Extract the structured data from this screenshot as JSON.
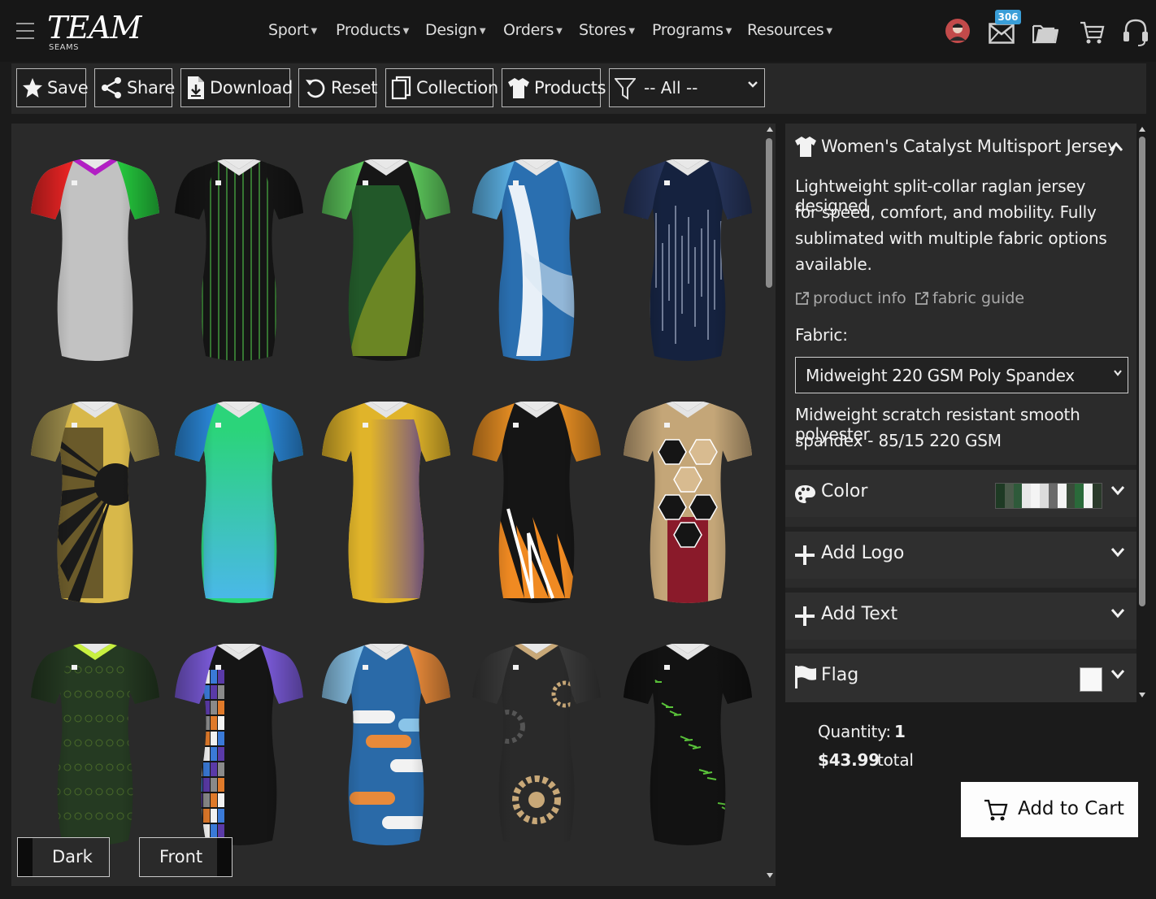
{
  "header": {
    "logo_text": "TEAM",
    "logo_sub": "SEAMS",
    "nav": [
      "Sport",
      "Products",
      "Design",
      "Orders",
      "Stores",
      "Programs",
      "Resources"
    ],
    "mail_count": "306",
    "icons": [
      "menu-icon",
      "avatar-icon",
      "mail-icon",
      "folder-icon",
      "cart-icon",
      "headset-icon"
    ]
  },
  "toolbar": {
    "save": "Save",
    "share": "Share",
    "download": "Download",
    "reset": "Reset",
    "collection": "Collection",
    "products": "Products",
    "filter_value": "-- All --"
  },
  "gallery": {
    "view_buttons": [
      "Dark",
      "Front"
    ],
    "jerseys": [
      {
        "design": "solid",
        "body": "#c2c2c2",
        "sleeve": "#24c43c",
        "sleeve_left": "#e82424",
        "collar": "#b21fc4",
        "accent": "#9a9a9a"
      },
      {
        "design": "stripes",
        "body": "#151515",
        "sleeve": "#151515",
        "collar": "#e4e4e4",
        "accent": "#3f8f3a"
      },
      {
        "design": "hex",
        "body": "#161616",
        "sleeve": "#5bc45a",
        "collar": "#e4e4e4",
        "accent": "#2e8f3a"
      },
      {
        "design": "swoosh",
        "body": "#2a6fb0",
        "sleeve": "#5aaee0",
        "collar": "#e4e4e4",
        "accent": "#d8e8f4"
      },
      {
        "design": "drips",
        "body": "#15223f",
        "sleeve": "#26345a",
        "collar": "#e4e4e4",
        "accent": "#b8c4dc"
      },
      {
        "design": "rays",
        "body": "#d8b84a",
        "sleeve": "#9a8a4a",
        "collar": "#e4e4e4",
        "accent": "#1a1a1a"
      },
      {
        "design": "grad",
        "body": "#2bd47a",
        "sleeve": "#2a86d6",
        "collar": "#e4e4e4",
        "accent": "#4ab8e8"
      },
      {
        "design": "grad2",
        "body": "#e0b42a",
        "sleeve": "#e0b42a",
        "collar": "#e4e4e4",
        "accent": "#5a3e9a"
      },
      {
        "design": "shards",
        "body": "#151515",
        "sleeve": "#e08a22",
        "collar": "#e4e4e4",
        "accent": "#f08a22"
      },
      {
        "design": "hexbig",
        "body": "#c4a678",
        "sleeve": "#c4a678",
        "collar": "#e4e4e4",
        "accent": "#8a1a2a"
      },
      {
        "design": "mesh",
        "body": "#253a22",
        "sleeve": "#253a22",
        "collar": "#c8f040",
        "accent": "#4a6a2a"
      },
      {
        "design": "blocks",
        "body": "#151515",
        "sleeve": "#7a5ad8",
        "collar": "#e4e4e4",
        "accent": "#e07a2a"
      },
      {
        "design": "blobs",
        "body": "#2a6aa8",
        "sleeve": "#e88a3a",
        "sleeve_left": "#8ac4e8",
        "collar": "#e4e4e4",
        "accent": "#f2f2f2"
      },
      {
        "design": "gears",
        "body": "#2a2a2a",
        "sleeve": "#3a3a3a",
        "collar": "#c8a878",
        "accent": "#c8a878"
      },
      {
        "design": "splatter",
        "body": "#121212",
        "sleeve": "#121212",
        "collar": "#e4e4e4",
        "accent": "#5ac43a"
      }
    ]
  },
  "product": {
    "title": "Women's Catalyst Multisport Jersey",
    "description_lines": [
      "Lightweight split-collar raglan jersey designed",
      "for speed, comfort, and mobility. Fully",
      "sublimated with multiple fabric options",
      "available."
    ],
    "link_info": "product info",
    "link_fabric": "fabric guide",
    "fabric_label": "Fabric:",
    "fabric_value": "Midweight 220 GSM Poly Spandex",
    "fabric_desc_lines": [
      "Midweight scratch resistant smooth polyester",
      "spandex - 85/15 220 GSM"
    ],
    "sections": [
      "Color",
      "Add Logo",
      "Add Text",
      "Flag"
    ],
    "color_swatches": [
      "#1e3a24",
      "#4a5a4a",
      "#2e5a3a",
      "#e8e8e8",
      "#f4f4f4",
      "#dcdcdc",
      "#6a6a6a",
      "#f4f4f4",
      "#3a4a3a",
      "#2a6a3a",
      "#f4f4f4",
      "#2a3a2a"
    ],
    "flag_color": "#f8f8f8"
  },
  "order": {
    "quantity_label": "Quantity:",
    "quantity": "1",
    "price": "$43.99",
    "total_label": "total",
    "add_to_cart": "Add to Cart"
  }
}
